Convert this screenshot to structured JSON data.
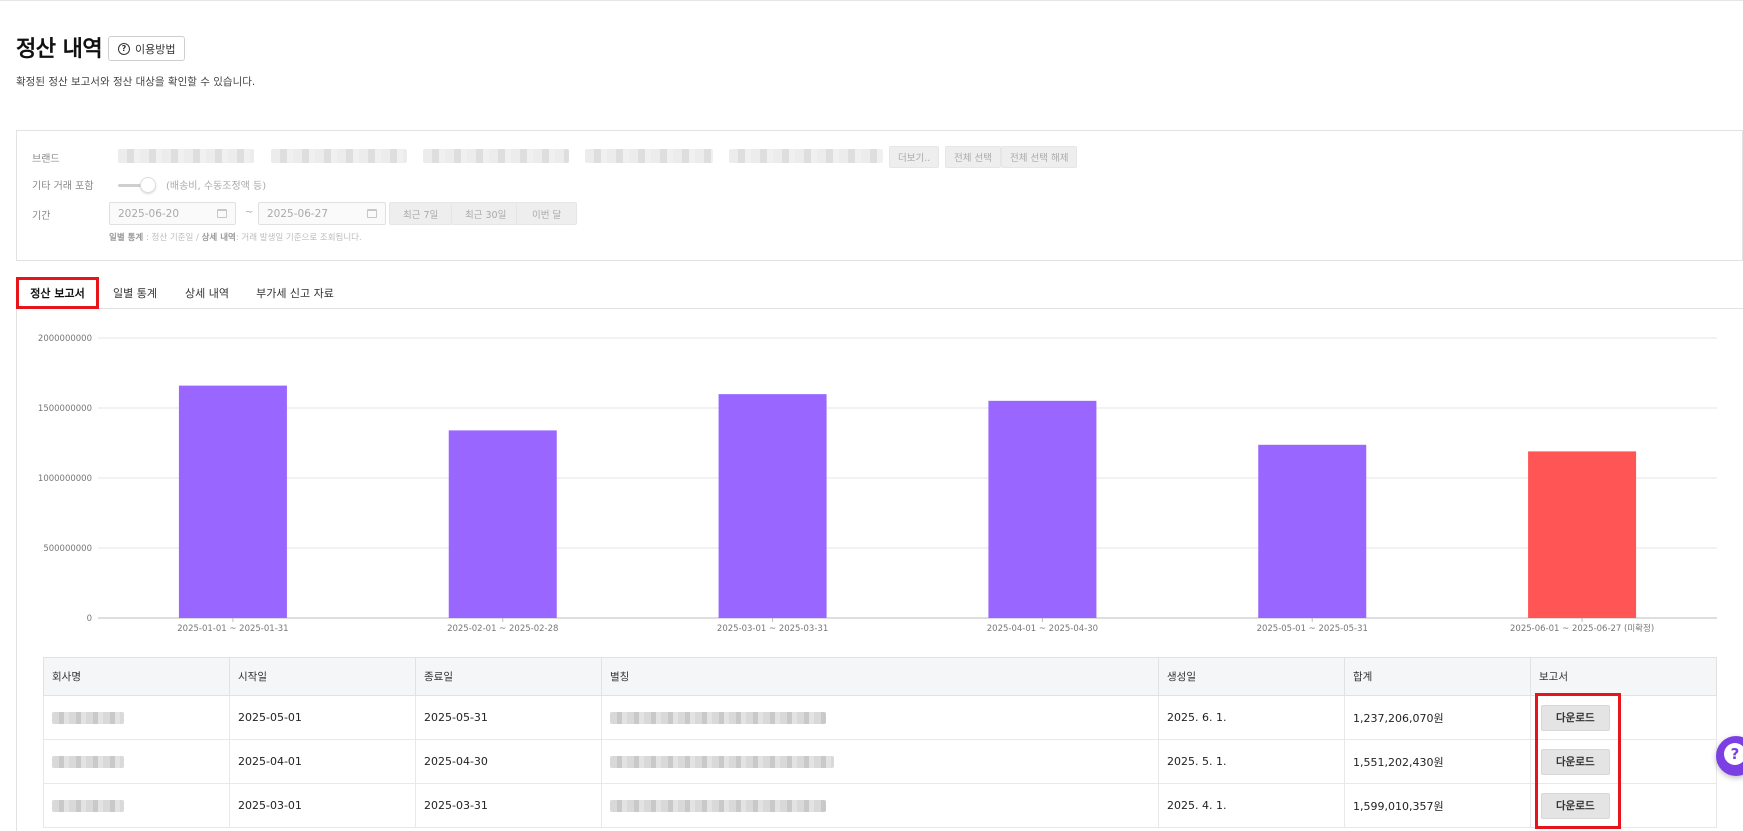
{
  "page": {
    "title": "정산 내역",
    "help_label": "이용방법",
    "subtitle": "확정된 정산 보고서와 정산 대상을 확인할 수 있습니다."
  },
  "filter": {
    "brand_label": "브랜드",
    "brand_more": "더보기..",
    "select_all": "전체 선택",
    "deselect_all": "전체 선택 해제",
    "other_label": "기타 거래 포함",
    "other_note": "(배송비, 수동조정액 등)",
    "period_label": "기간",
    "start_date": "2025-06-20",
    "tilde": "~",
    "end_date": "2025-06-27",
    "quick_7": "최근 7일",
    "quick_30": "최근 30일",
    "quick_month": "이번 달",
    "note_daily_key": "일별 통계",
    "note_daily_val": ": 정산 기준일 /",
    "note_detail_key": "상세 내역",
    "note_detail_val": ": 거래 발생일 기준으로 조회됩니다."
  },
  "tabs": [
    {
      "label": "정산 보고서",
      "active": true
    },
    {
      "label": "일별 통계",
      "active": false
    },
    {
      "label": "상세 내역",
      "active": false
    },
    {
      "label": "부가세 신고 자료",
      "active": false
    }
  ],
  "chart_data": {
    "type": "bar",
    "categories": [
      "2025-01-01 ~ 2025-01-31",
      "2025-02-01 ~ 2025-02-28",
      "2025-03-01 ~ 2025-03-31",
      "2025-04-01 ~ 2025-04-30",
      "2025-05-01 ~ 2025-05-31",
      "2025-06-01 ~ 2025-06-27 (미확정)"
    ],
    "values": [
      1660000000,
      1340000000,
      1599010357,
      1551202430,
      1237206070,
      1190000000
    ],
    "bar_colors": [
      "#9966ff",
      "#9966ff",
      "#9966ff",
      "#9966ff",
      "#9966ff",
      "#ff5555"
    ],
    "ylim": [
      0,
      2000000000
    ],
    "yticks": [
      "0",
      "500000000",
      "1000000000",
      "1500000000",
      "2000000000"
    ],
    "grid": true,
    "xlabel": "",
    "ylabel": ""
  },
  "table": {
    "headers": [
      "회사명",
      "시작일",
      "종료일",
      "별칭",
      "생성일",
      "합계",
      "보고서"
    ],
    "download_label": "다운로드",
    "rows": [
      {
        "start": "2025-05-01",
        "end": "2025-05-31",
        "created": "2025. 6. 1.",
        "total": "1,237,206,070원"
      },
      {
        "start": "2025-04-01",
        "end": "2025-04-30",
        "created": "2025. 5. 1.",
        "total": "1,551,202,430원"
      },
      {
        "start": "2025-03-01",
        "end": "2025-03-31",
        "created": "2025. 4. 1.",
        "total": "1,599,010,357원"
      }
    ]
  },
  "fab_icon": "help-icon",
  "fab_glyph": "?"
}
